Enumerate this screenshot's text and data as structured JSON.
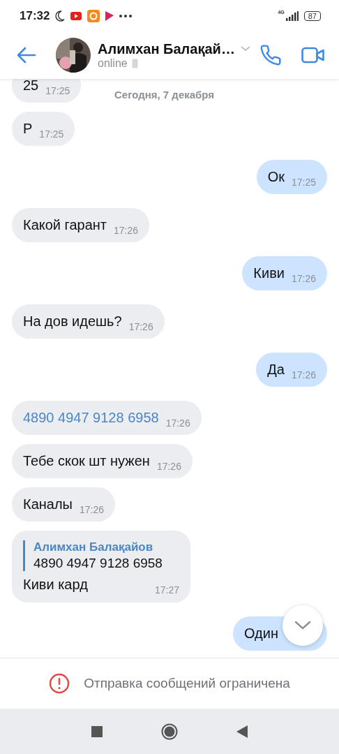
{
  "status_bar": {
    "time": "17:32",
    "network": "4G",
    "battery": "87"
  },
  "header": {
    "name": "Алимхан Балақай…",
    "status": "online"
  },
  "date_label": "Сегодня, 7 декабря",
  "messages": [
    {
      "outgoing": false,
      "kind": "text",
      "text": "25",
      "time": "17:25"
    },
    {
      "outgoing": false,
      "kind": "text",
      "text": "Р",
      "time": "17:25"
    },
    {
      "outgoing": true,
      "kind": "text",
      "text": "Ок",
      "time": "17:25"
    },
    {
      "outgoing": false,
      "kind": "text",
      "text": "Какой гарант",
      "time": "17:26"
    },
    {
      "outgoing": true,
      "kind": "text",
      "text": "Киви",
      "time": "17:26"
    },
    {
      "outgoing": false,
      "kind": "text",
      "text": "На дов идешь?",
      "time": "17:26"
    },
    {
      "outgoing": true,
      "kind": "text",
      "text": "Да",
      "time": "17:26"
    },
    {
      "outgoing": false,
      "kind": "link",
      "text": "4890 4947 9128 6958",
      "time": "17:26"
    },
    {
      "outgoing": false,
      "kind": "text",
      "text": "Тебе скок шт нужен",
      "time": "17:26"
    },
    {
      "outgoing": false,
      "kind": "text",
      "text": "Каналы",
      "time": "17:26"
    },
    {
      "outgoing": false,
      "kind": "reply",
      "reply_author": "Алимхан Балақайов",
      "reply_text": "4890 4947 9128 6958",
      "text": "Киви кард",
      "time": "17:27"
    },
    {
      "outgoing": true,
      "kind": "text",
      "text": "Один"
    }
  ],
  "notice": "Отправка сообщений ограничена"
}
